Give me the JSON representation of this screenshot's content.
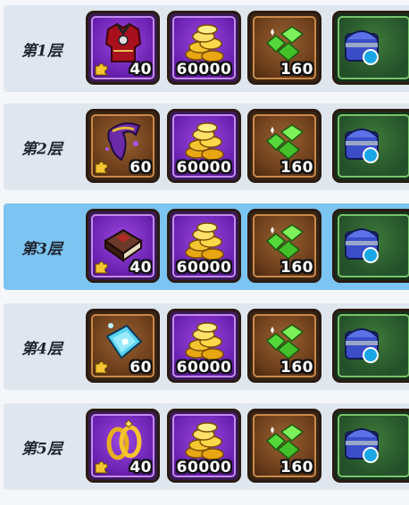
{
  "floors": [
    {
      "label": "第1层",
      "piece_count": "40",
      "gold": "60000",
      "gems": "160",
      "item_icon": "red-armor-icon"
    },
    {
      "label": "第2层",
      "piece_count": "60",
      "gold": "60000",
      "gems": "160",
      "item_icon": "purple-cloak-icon"
    },
    {
      "label": "第3层",
      "piece_count": "40",
      "gold": "60000",
      "gems": "160",
      "item_icon": "spellbook-icon"
    },
    {
      "label": "第4层",
      "piece_count": "60",
      "gold": "60000",
      "gems": "160",
      "item_icon": "ice-crystal-icon"
    },
    {
      "label": "第5层",
      "piece_count": "40",
      "gold": "60000",
      "gems": "160",
      "item_icon": "golden-rings-icon"
    }
  ],
  "active_floor_index": 2,
  "colors": {
    "row_bg": "#dfe6ee",
    "row_active_bg": "#7cc4f1",
    "purple_tile": "#6a21b0",
    "brown_tile": "#6b3d1a",
    "green_tile": "#24512a"
  }
}
